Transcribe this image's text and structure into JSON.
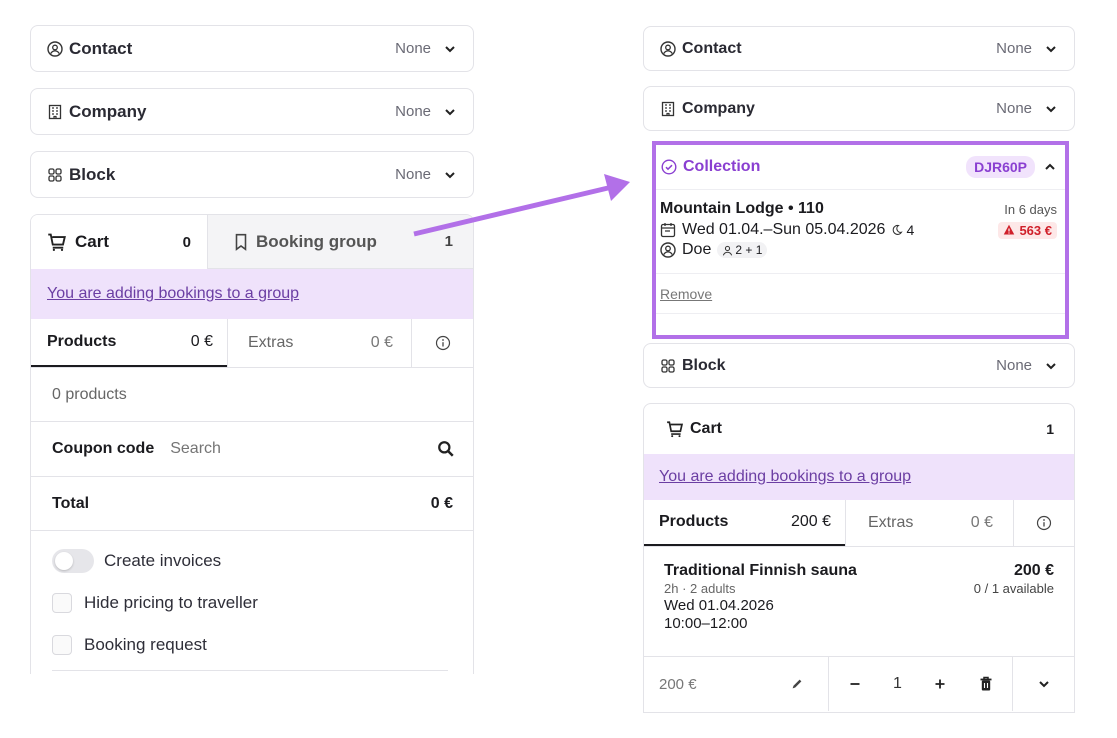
{
  "left": {
    "contact": {
      "label": "Contact",
      "value": "None"
    },
    "company": {
      "label": "Company",
      "value": "None"
    },
    "block": {
      "label": "Block",
      "value": "None"
    },
    "cart_tab": {
      "label": "Cart",
      "count": "0"
    },
    "booking_group_tab": {
      "label": "Booking group",
      "count": "1"
    },
    "group_notice": "You are adding bookings to a group",
    "products_tab": {
      "label": "Products",
      "amount": "0 €"
    },
    "extras_tab": {
      "label": "Extras",
      "amount": "0 €"
    },
    "products_count": "0 products",
    "coupon": {
      "label": "Coupon code",
      "placeholder": "Search"
    },
    "total": {
      "label": "Total",
      "value": "0 €"
    },
    "options": {
      "create_invoices": "Create invoices",
      "hide_pricing": "Hide pricing to traveller",
      "booking_request": "Booking request"
    }
  },
  "right": {
    "contact": {
      "label": "Contact",
      "value": "None"
    },
    "company": {
      "label": "Company",
      "value": "None"
    },
    "collection": {
      "label": "Collection",
      "code": "DJR60P",
      "room": "Mountain Lodge • 110",
      "due": "In 6 days",
      "dates": "Wed 01.04.–Sun 05.04.2026",
      "nights": "4",
      "guest": "Doe",
      "guests_count": "2 + 1",
      "amount": "563 €",
      "remove": "Remove"
    },
    "block": {
      "label": "Block",
      "value": "None"
    },
    "cart": {
      "label": "Cart",
      "count": "1"
    },
    "group_notice": "You are adding bookings to a group",
    "products_tab": {
      "label": "Products",
      "amount": "200 €"
    },
    "extras_tab": {
      "label": "Extras",
      "amount": "0 €"
    },
    "item": {
      "name": "Traditional Finnish sauna",
      "price": "200 €",
      "meta": "2h · 2 adults",
      "availability": "0 / 1 available",
      "date": "Wed 01.04.2026",
      "time": "10:00–12:00",
      "line_price": "200 €",
      "qty": "1"
    }
  },
  "colors": {
    "accent": "#b270e8",
    "link": "#6b3ea3",
    "danger": "#d0202a",
    "notice_bg": "#efe2fb"
  }
}
